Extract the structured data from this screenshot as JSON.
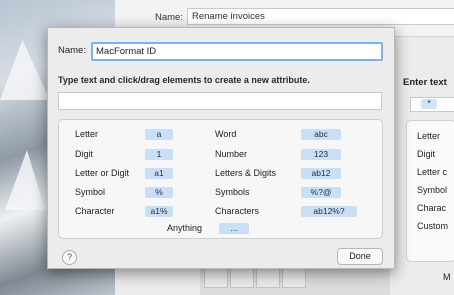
{
  "background_window": {
    "name_label": "Name:",
    "name_value": "Rename invoices",
    "enter_text_label": "Enter text",
    "field_token": "*",
    "elements": [
      "Letter",
      "Digit",
      "Letter c",
      "Symbol",
      "Charac",
      "Custom"
    ],
    "bottom_letter": "M"
  },
  "sheet": {
    "name_label": "Name:",
    "name_value": "MacFormat ID",
    "instructions": "Type text and click/drag elements to create a new attribute.",
    "elements": [
      {
        "label": "Letter",
        "token": "a"
      },
      {
        "label": "Digit",
        "token": "1"
      },
      {
        "label": "Letter or Digit",
        "token": "a1"
      },
      {
        "label": "Symbol",
        "token": "%"
      },
      {
        "label": "Character",
        "token": "a1%"
      },
      {
        "label": "Word",
        "token": "abc"
      },
      {
        "label": "Number",
        "token": "123"
      },
      {
        "label": "Letters & Digits",
        "token": "ab12"
      },
      {
        "label": "Symbols",
        "token": "%?@"
      },
      {
        "label": "Characters",
        "token": "ab12%?"
      },
      {
        "label": "Anything",
        "token": "..."
      }
    ],
    "help_label": "?",
    "done_label": "Done"
  },
  "colors": {
    "token_bg": "#c9dff6",
    "focus_ring": "#7fb0ee"
  }
}
